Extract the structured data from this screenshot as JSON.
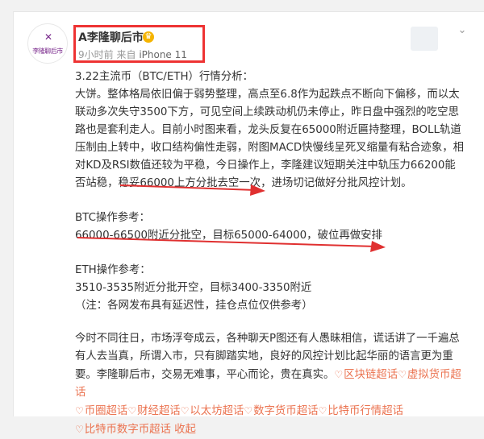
{
  "post": {
    "author": {
      "name": "A李隆聊后市",
      "badge_icon": "verified-badge-icon",
      "avatar_text": "李隆聊后市"
    },
    "meta": {
      "time": "9小时前",
      "source_prefix": "来自",
      "source": "iPhone 11"
    },
    "title_line": "3.22主流币（BTC/ETH）行情分析：",
    "paragraph_lines": [
      "大饼。整体格局依旧偏于弱势整理，高点至6.8作为起跌点不断向下偏移，而以太",
      "联动多次失守3500下方，可见空间上续跌动机仍未停止，昨日盘中强烈的吃空思",
      "路也是套利走人。目前小时图来看，龙头反复在65000附近匾持整理，BOLL轨道",
      "压制由上转中，收口结构偏性走弱，附图MACD快慢线呈死叉缩量有粘合迹象，相",
      "对KD及RSI数值还较为平稳，今日操作上，李隆建议短期关注中轨压力66200能",
      "否站稳，稳妥66000上方分批去空一次，进场切记做好分批风控计划。"
    ],
    "btc": {
      "heading": "BTC操作参考：",
      "line": "66000-66500附近分批空，目标65000-64000，破位再做安排"
    },
    "eth": {
      "heading": "ETH操作参考：",
      "line": "3510-3535附近分批开空，目标3400-3350附近",
      "note": "（注：各网发布具有延迟性，挂仓点位仅供参考）"
    },
    "closing_lines": [
      "今时不同往日，市场浮夸成云，各种聊天P图还有人愚昧相信，谎话讲了一千遍总",
      "有人去当真，所谓入市，只有脚踏实地，良好的风控计划比起华丽的语言更为重",
      "要。李隆聊后市，交易无难事，平心而论，贵在真实。"
    ],
    "topics": [
      "区块链超话",
      "虚拟货币超话",
      "币圈超话",
      "财经超话",
      "以太坊超话",
      "数字货币超话",
      "比特币行情超话",
      "比特币数字币超话"
    ],
    "collapse_label": "收起"
  },
  "colors": {
    "highlight_box": "#ee3333",
    "annotation_arrow": "#e03030",
    "topic_link": "#eb7350",
    "meta_text": "#999999"
  }
}
